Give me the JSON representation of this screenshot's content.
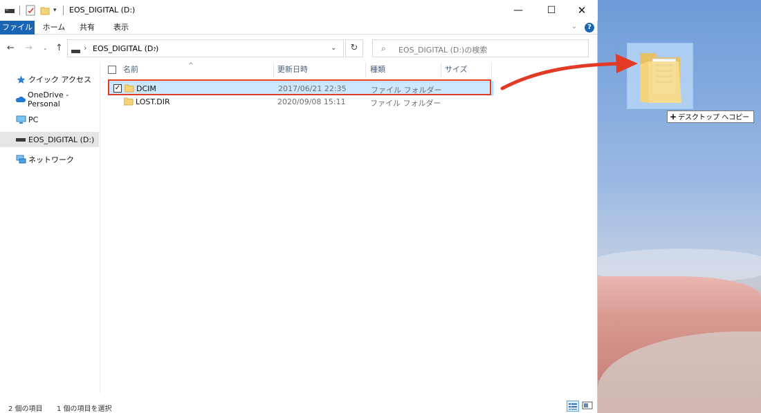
{
  "window": {
    "title": "EOS_DIGITAL (D:)",
    "minimize": "—",
    "maximize": "☐",
    "close": "✕"
  },
  "ribbon": {
    "tabs": [
      "ファイル",
      "ホーム",
      "共有",
      "表示"
    ],
    "help": "?"
  },
  "navigation": {
    "back": "←",
    "forward": "→",
    "recent": "⌄",
    "up": "↑",
    "address_path": "EOS_DIGITAL (D:)",
    "refresh": "↻",
    "search_placeholder": "EOS_DIGITAL (D:)の検索"
  },
  "navpane": {
    "items": [
      {
        "label": "クイック アクセス",
        "icon": "star-icon"
      },
      {
        "label": "OneDrive - Personal",
        "icon": "cloud-icon"
      },
      {
        "label": "PC",
        "icon": "pc-icon"
      },
      {
        "label": "EOS_DIGITAL (D:)",
        "icon": "drive-icon",
        "selected": true
      },
      {
        "label": "ネットワーク",
        "icon": "network-icon"
      }
    ]
  },
  "filelist": {
    "columns": [
      "名前",
      "更新日時",
      "種類",
      "サイズ"
    ],
    "rows": [
      {
        "name": "DCIM",
        "date": "2017/06/21 22:35",
        "type": "ファイル フォルダー",
        "selected": true
      },
      {
        "name": "LOST.DIR",
        "date": "2020/09/08 15:11",
        "type": "ファイル フォルダー",
        "selected": false
      }
    ]
  },
  "status": {
    "count": "2 個の項目",
    "selected": "1 個の項目を選択"
  },
  "desktop": {
    "copy_tooltip": "デスクトップ へコピー",
    "copy_plus": "+"
  },
  "colors": {
    "accent": "#1a64b4",
    "selection": "#cce8ff",
    "annotation": "#e13a25"
  }
}
